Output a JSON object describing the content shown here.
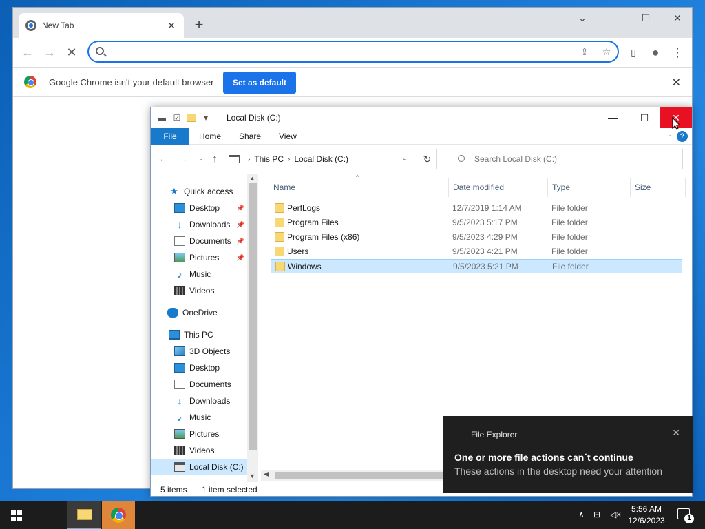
{
  "chrome": {
    "tab_title": "New Tab",
    "omnibox_value": "",
    "infobar_text": "Google Chrome isn't your default browser",
    "set_default_label": "Set as default"
  },
  "explorer": {
    "title": "Local Disk (C:)",
    "ribbon_tabs": [
      "File",
      "Home",
      "Share",
      "View"
    ],
    "breadcrumb": [
      "This PC",
      "Local Disk (C:)"
    ],
    "search_placeholder": "Search Local Disk (C:)",
    "nav": {
      "quick_access": "Quick access",
      "quick_items": [
        {
          "label": "Desktop",
          "pinned": true
        },
        {
          "label": "Downloads",
          "pinned": true
        },
        {
          "label": "Documents",
          "pinned": true
        },
        {
          "label": "Pictures",
          "pinned": true
        },
        {
          "label": "Music",
          "pinned": false
        },
        {
          "label": "Videos",
          "pinned": false
        }
      ],
      "onedrive": "OneDrive",
      "this_pc": "This PC",
      "pc_items": [
        "3D Objects",
        "Desktop",
        "Documents",
        "Downloads",
        "Music",
        "Pictures",
        "Videos",
        "Local Disk (C:)"
      ]
    },
    "columns": [
      "Name",
      "Date modified",
      "Type",
      "Size"
    ],
    "rows": [
      {
        "name": "PerfLogs",
        "date": "12/7/2019 1:14 AM",
        "type": "File folder",
        "selected": false
      },
      {
        "name": "Program Files",
        "date": "9/5/2023 5:17 PM",
        "type": "File folder",
        "selected": false
      },
      {
        "name": "Program Files (x86)",
        "date": "9/5/2023 4:29 PM",
        "type": "File folder",
        "selected": false
      },
      {
        "name": "Users",
        "date": "9/5/2023 4:21 PM",
        "type": "File folder",
        "selected": false
      },
      {
        "name": "Windows",
        "date": "9/5/2023 5:21 PM",
        "type": "File folder",
        "selected": true
      }
    ],
    "status_items": "5 items",
    "status_selected": "1 item selected"
  },
  "toast": {
    "app": "File Explorer",
    "title": "One or more file actions can´t continue",
    "body": "These actions in the desktop need your attention"
  },
  "taskbar": {
    "time": "5:56 AM",
    "date": "12/6/2023",
    "notification_count": "1"
  },
  "colors": {
    "accent": "#1979ca",
    "chrome_blue": "#1a73e8",
    "selection": "#cce8ff",
    "close_red": "#e81123"
  }
}
